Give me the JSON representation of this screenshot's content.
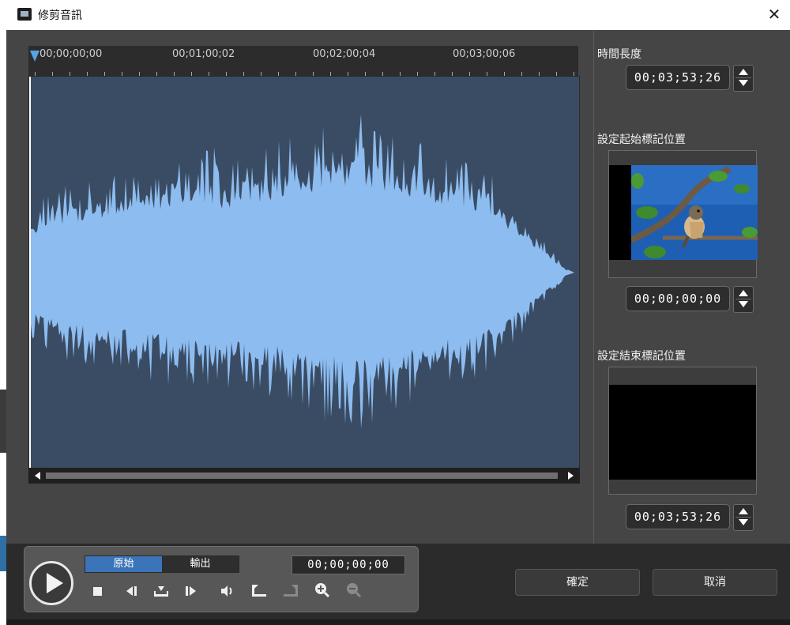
{
  "window": {
    "title": "修剪音訊",
    "close_glyph": "✕"
  },
  "timeline": {
    "labels": [
      "00;00;00;00",
      "00;01;00;02",
      "00;02;00;04",
      "00;03;00;06"
    ]
  },
  "side": {
    "duration_label": "時間長度",
    "duration_value": "00;03;53;26",
    "start_mark_label": "設定起始標記位置",
    "start_mark_value": "00;00;00;00",
    "end_mark_label": "設定結束標記位置",
    "end_mark_value": "00;03;53;26"
  },
  "controls": {
    "tab_original": "原始",
    "tab_output": "輸出",
    "current_time": "00;00;00;00",
    "icons": [
      "play-icon",
      "stop-icon",
      "previous-frame-icon",
      "mark-in-out-icon",
      "next-frame-icon",
      "volume-icon",
      "set-start-mark-icon",
      "set-end-mark-icon",
      "zoom-in-icon",
      "zoom-out-icon"
    ]
  },
  "buttons": {
    "ok": "確定",
    "cancel": "取消"
  },
  "colors": {
    "waveform_fill": "#8dbcf0",
    "waveform_bg": "#3a4c63",
    "accent": "#3b74b8"
  }
}
